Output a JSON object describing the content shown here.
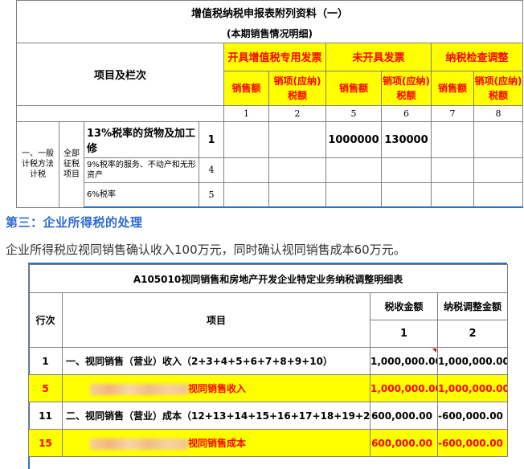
{
  "table1": {
    "title": "增值税纳税申报表附列资料（一）",
    "subtitle": "(本期销售情况明细)",
    "item_header": "项目及栏次",
    "groups": [
      "开具增值税专用发票",
      "未开具发票",
      "纳税检查调整"
    ],
    "sub_headers": [
      "销售额",
      "销项(应纳)税额",
      "销售额",
      "销项(应纳)税额",
      "销售额",
      "销项(应纳)税额"
    ],
    "col_nums": [
      "1",
      "2",
      "5",
      "6",
      "7",
      "8"
    ],
    "method_label": "一、一般计税方法计税",
    "scope_label": "全部征税项目",
    "rows": [
      {
        "name": "13%税率的货物及加工修",
        "line": "1",
        "values": [
          "",
          "",
          "1000000",
          "130000",
          "",
          ""
        ]
      },
      {
        "name": "9%税率的服务、不动产和无形资产",
        "line": "4",
        "values": [
          "",
          "",
          "",
          "",
          "",
          ""
        ]
      },
      {
        "name": "6%税率",
        "line": "5",
        "values": [
          "",
          "",
          "",
          "",
          "",
          ""
        ]
      }
    ]
  },
  "heading": "第三：企业所得税的处理",
  "paragraph": "企业所得税应视同销售确认收入100万元，同时确认视同销售成本60万元。",
  "table2": {
    "title": "A105010视同销售和房地产开发企业特定业务纳税调整明细表",
    "col_row_no": "行次",
    "col_item": "项目",
    "col_tax_income": "税收金额",
    "col_adjust": "纳税调整金额",
    "col_num1": "1",
    "col_num2": "2",
    "rows": [
      {
        "no": "1",
        "item": "一、视同销售（营业）收入（2+3+4+5+6+7+8+9+10）",
        "tax": "1,000,000.00",
        "adj": "1,000,000.00",
        "highlight": false
      },
      {
        "no": "5",
        "item": "视同销售收入",
        "tax": "1,000,000.00",
        "adj": "1,000,000.00",
        "highlight": true
      },
      {
        "no": "11",
        "item": "二、视同销售（营业）成本（12+13+14+15+16+17+18+19+20）",
        "tax": "600,000.00",
        "adj": "-600,000.00",
        "highlight": false
      },
      {
        "no": "15",
        "item": "视同销售成本",
        "tax": "600,000.00",
        "adj": "-600,000.00",
        "highlight": true
      }
    ]
  },
  "colors": {
    "highlight_bg": "#ffff00",
    "highlight_text": "#ff0000",
    "heading": "#2d6bd2",
    "accent_border": "#2e75b6"
  }
}
